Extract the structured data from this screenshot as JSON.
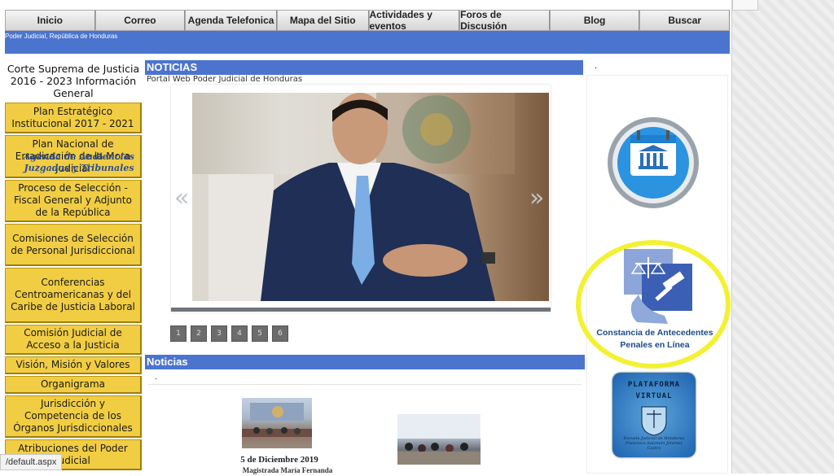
{
  "topnav": [
    "Inicio",
    "Correo",
    "Agenda Telefonica",
    "Mapa del Sitio",
    "Actividades y eventos",
    "Foros de Discusión",
    "Blog",
    "Buscar"
  ],
  "brand": "Poder Judicial, República de Honduras",
  "sidebar": {
    "title": "Corte Suprema de Justicia 2016 - 2023 Información General",
    "items": [
      "Plan Estratégico Institucional 2017 - 2021",
      "Plan Nacional de Erradicación de la Mora Judicial",
      "Proceso de Selección - Fiscal General y Adjunto de la República",
      "Comisiones de Selección de Personal Jurisdiccional",
      "Conferencias Centroamericanas y del Caribe de Justicia Laboral",
      "Comisión Judicial de Acceso a la Justicia",
      "Visión, Misión y Valores",
      "Organigrama",
      "Jurisdicción y Competencia de los Órganos Jurisdiccionales",
      "Atribuciones del Poder Judicial"
    ]
  },
  "main": {
    "noticias_header": "NOTICIAS",
    "portal_text": "Portal Web Poder Judicial de Honduras",
    "pager": [
      "1",
      "2",
      "3",
      "4",
      "5",
      "6"
    ],
    "news_header": "Noticias",
    "news_dot": ".",
    "news_date": "5 de Diciembre 2019",
    "news_sub": "Magistrada María Fernanda"
  },
  "right": {
    "dot": ".",
    "agenda_label": "Agenda de Audiencias Juzgados y Tribunales",
    "constancia_label": "Constancia de Antecedentes Penales en Línea",
    "plataforma_title": "PLATAFORMA VIRTUAL",
    "plataforma_mini": "Escuela Judicial de Honduras Francisco Salomón Jiménez Castro"
  },
  "statusbar": "/default.aspx",
  "colors": {
    "nav_blue": "#4b74cf",
    "sidebar_yellow": "#f1cd43",
    "highlight_yellow": "#f2ef1c"
  }
}
